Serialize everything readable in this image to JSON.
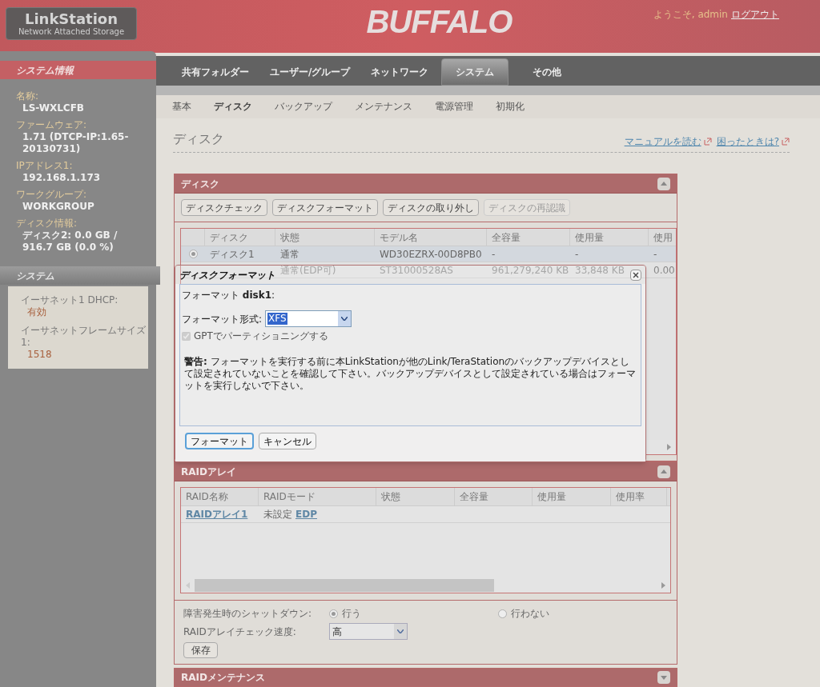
{
  "header": {
    "brand_title": "LinkStation",
    "brand_subtitle": "Network Attached Storage",
    "logo": "BUFFALO",
    "welcome": "ようこそ, admin",
    "logout": "ログアウト"
  },
  "nav": {
    "tabs": [
      {
        "label": "共有フォルダー",
        "selected": false
      },
      {
        "label": "ユーザー/グループ",
        "selected": false
      },
      {
        "label": "ネットワーク",
        "selected": false
      },
      {
        "label": "システム",
        "selected": true
      },
      {
        "label": "その他",
        "selected": false
      }
    ],
    "subtabs": [
      {
        "label": "基本",
        "selected": false
      },
      {
        "label": "ディスク",
        "selected": true
      },
      {
        "label": "バックアップ",
        "selected": false
      },
      {
        "label": "メンテナンス",
        "selected": false
      },
      {
        "label": "電源管理",
        "selected": false
      },
      {
        "label": "初期化",
        "selected": false
      }
    ]
  },
  "sidebar": {
    "sections": [
      {
        "title": "システム情報",
        "kind": "info",
        "items": [
          {
            "label": "名称:",
            "value": "LS-WXLCFB"
          },
          {
            "label": "ファームウェア:",
            "value": "1.71 (DTCP-IP:1.65-20130731)"
          },
          {
            "label": "IPアドレス1:",
            "value": "192.168.1.173"
          },
          {
            "label": "ワークグループ:",
            "value": "WORKGROUP"
          },
          {
            "label": "ディスク情報:",
            "value": "**ディスク2:** 0.0 GB / 916.7 GB (0.0 %)"
          }
        ]
      },
      {
        "title": "システム",
        "kind": "system",
        "items": [
          {
            "label": "イーサネット1 DHCP:",
            "value": "有効"
          },
          {
            "label": "イーサネットフレームサイズ1:",
            "value": "1518"
          }
        ]
      }
    ]
  },
  "page": {
    "title": "ディスク",
    "links": [
      "マニュアルを読む",
      "困ったときは?"
    ]
  },
  "disk_panel": {
    "title": "ディスク",
    "collapsed": false,
    "buttons": [
      {
        "label": "ディスクチェック",
        "disabled": false
      },
      {
        "label": "ディスクフォーマット",
        "disabled": false
      },
      {
        "label": "ディスクの取り外し",
        "disabled": false
      },
      {
        "label": "ディスクの再認識",
        "disabled": true
      }
    ],
    "columns": [
      "ディスク",
      "状態",
      "モデル名",
      "全容量",
      "使用量",
      "使用"
    ],
    "rows": [
      {
        "selected": true,
        "cells": [
          "ディスク1",
          "通常",
          "WD30EZRX-00D8PB0",
          "-",
          "-",
          "-"
        ]
      },
      {
        "cells": [
          "",
          "通常(EDP可)",
          "ST31000528AS",
          "961,279,240 KB",
          "33,848 KB",
          "0.00"
        ]
      }
    ]
  },
  "dialog": {
    "title": "ディスクフォーマット",
    "heading": "フォーマット **disk1**:",
    "format_label": "フォーマット形式:",
    "format_value": "XFS",
    "gpt": {
      "label": "GPTでパーティショニングする",
      "checked": true,
      "disabled": true
    },
    "warning": "**警告:** フォーマットを実行する前に本LinkStationが他のLink/TeraStationのバックアップデバイスとして設定されていないことを確認して下さい。バックアップデバイスとして設定されている場合はフォーマットを実行しないで下さい。",
    "buttons": [
      {
        "label": "フォーマット",
        "focused": true
      },
      {
        "label": "キャンセル",
        "focused": false
      }
    ]
  },
  "raid_panel": {
    "title": "RAIDアレイ",
    "collapsed": false,
    "columns": [
      "RAID名称",
      "RAIDモード",
      "状態",
      "全容量",
      "使用量",
      "使用率"
    ],
    "rows": [
      {
        "cells": [
          [
            {
              "text": "RAIDアレイ1",
              "link": true
            }
          ],
          [
            {
              "text": "未設定",
              "link": false
            },
            {
              "text": "EDP",
              "link": true
            }
          ],
          [],
          [],
          [],
          []
        ]
      }
    ],
    "shutdown": {
      "label": "障害発生時のシャットダウン:",
      "options": [
        {
          "label": "行う",
          "selected": true
        },
        {
          "label": "行わない",
          "selected": false
        }
      ]
    },
    "check_speed": {
      "label": "RAIDアレイチェック速度:",
      "value": "高"
    },
    "save": "保存"
  },
  "maintenance_panel": {
    "title": "RAIDメンテナンス",
    "collapsed": true
  }
}
